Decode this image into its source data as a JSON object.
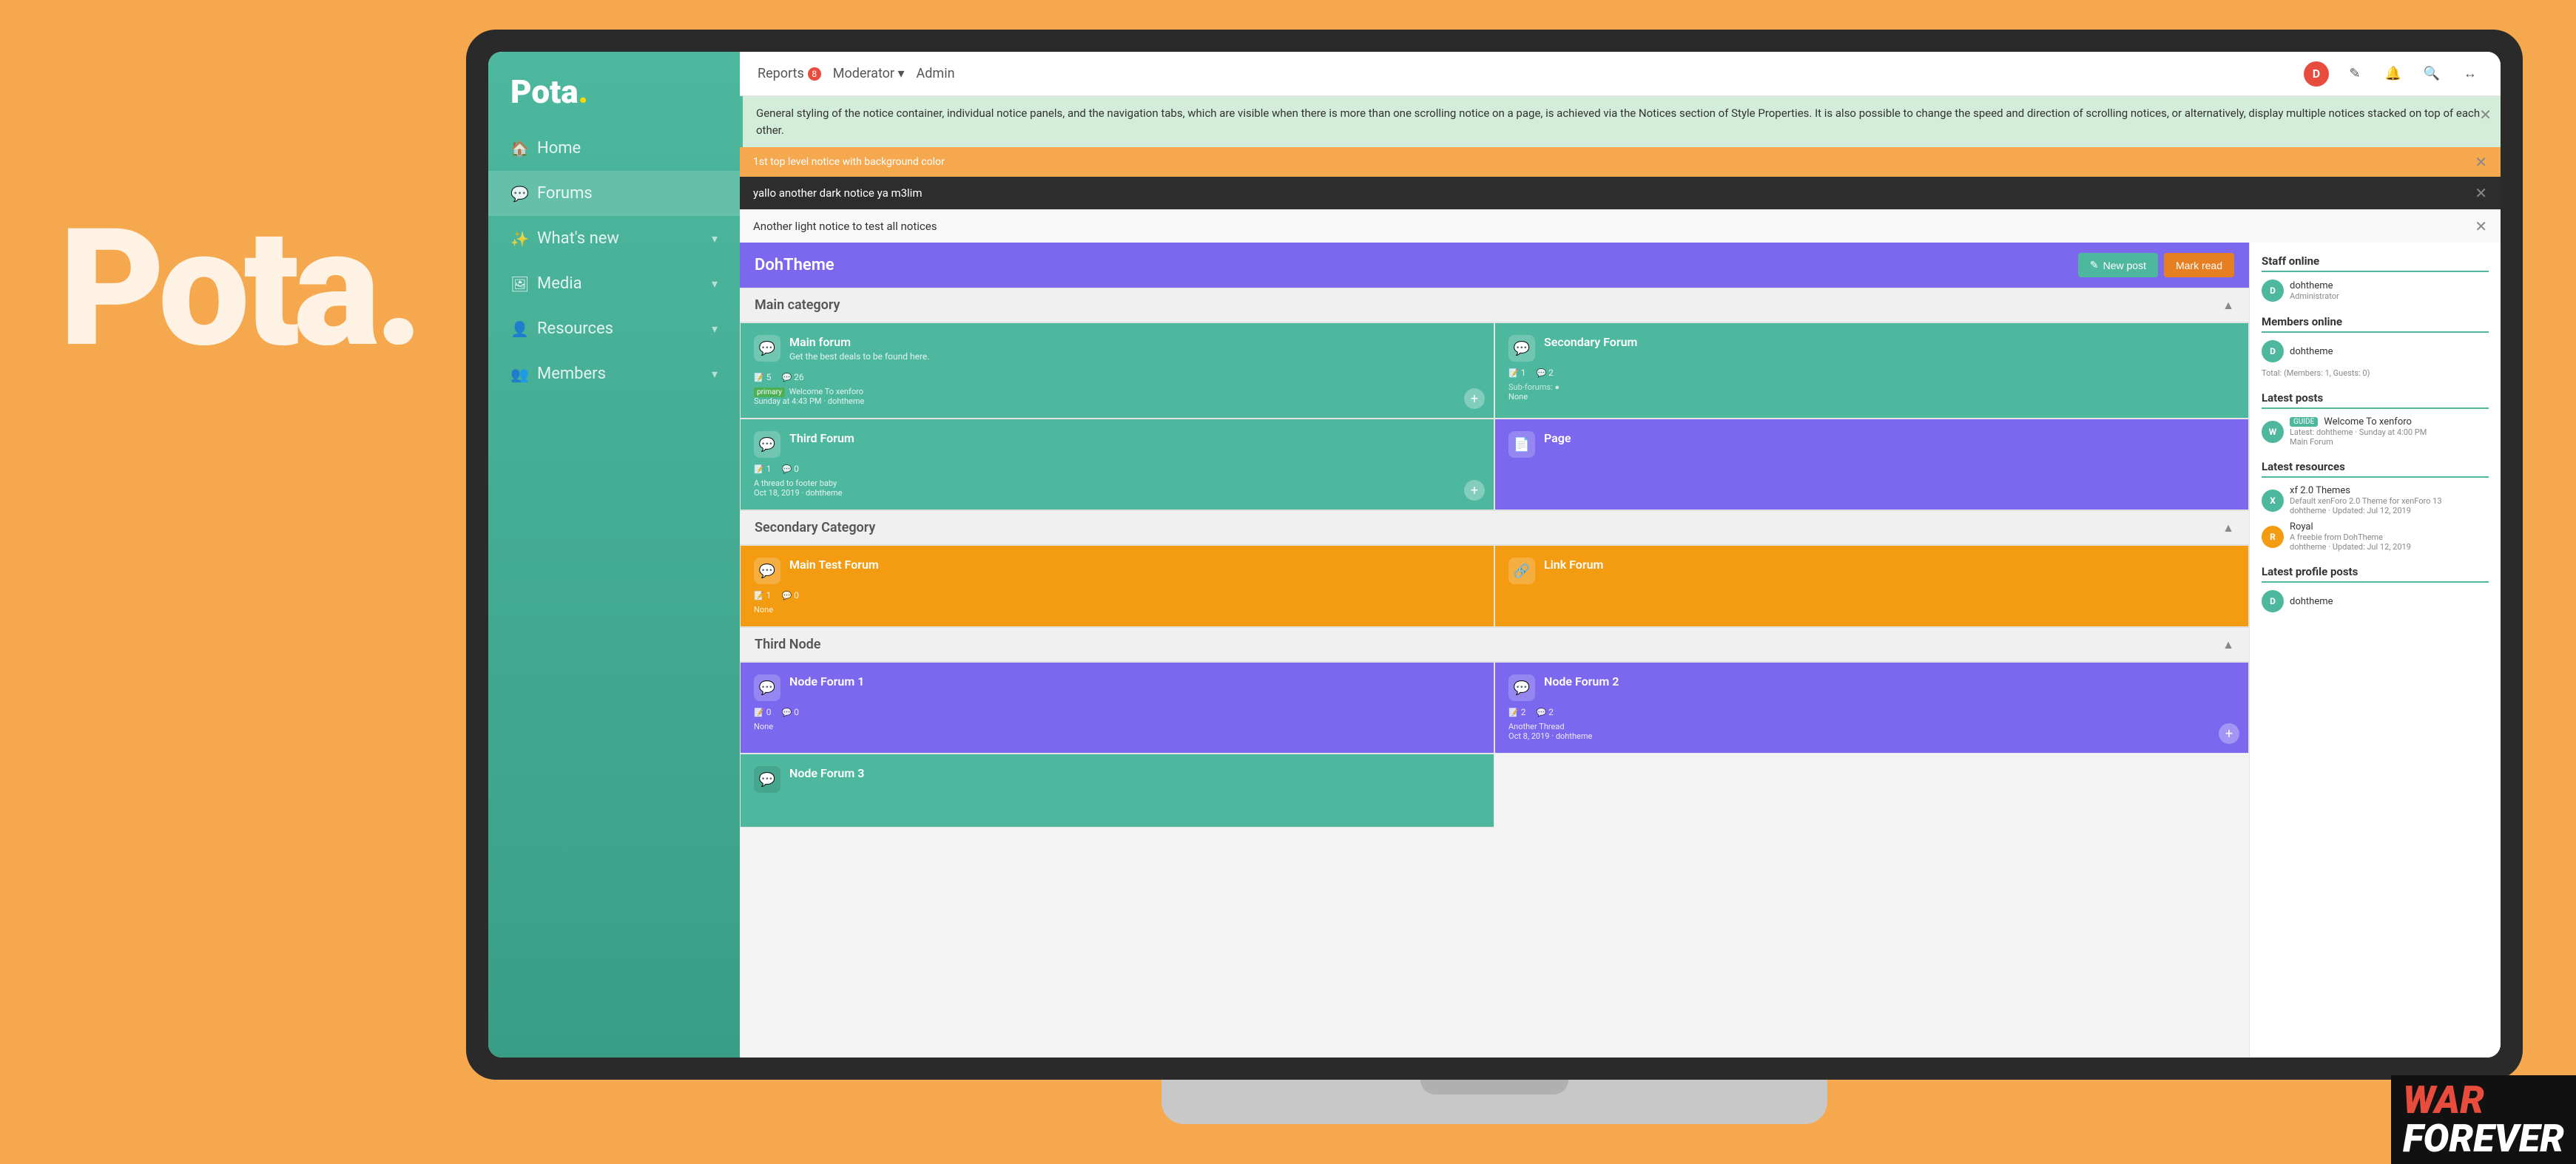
{
  "background": {
    "color": "#F5A84E"
  },
  "big_logo": "Pota.",
  "sidebar": {
    "logo": "Pota.",
    "logo_dot": ".",
    "nav_items": [
      {
        "id": "home",
        "icon": "🏠",
        "label": "Home",
        "active": false
      },
      {
        "id": "forums",
        "icon": "💬",
        "label": "Forums",
        "active": true
      },
      {
        "id": "whats-new",
        "icon": "✨",
        "label": "What's new",
        "active": false,
        "has_chevron": true
      },
      {
        "id": "media",
        "icon": "🖼",
        "label": "Media",
        "active": false,
        "has_chevron": true
      },
      {
        "id": "resources",
        "icon": "👤",
        "label": "Resources",
        "active": false,
        "has_chevron": true
      },
      {
        "id": "members",
        "icon": "👥",
        "label": "Members",
        "active": false,
        "has_chevron": true
      }
    ]
  },
  "top_navbar": {
    "links": [
      {
        "id": "reports",
        "label": "Reports",
        "badge": "8"
      },
      {
        "id": "moderator",
        "label": "Moderator ▾"
      },
      {
        "id": "admin",
        "label": "Admin"
      }
    ],
    "icons": [
      {
        "id": "avatar",
        "type": "avatar",
        "label": "D"
      },
      {
        "id": "compose",
        "symbol": "✎"
      },
      {
        "id": "alerts",
        "symbol": "🔔"
      },
      {
        "id": "search",
        "symbol": "🔍"
      },
      {
        "id": "more",
        "symbol": "↔"
      }
    ]
  },
  "notices": [
    {
      "id": "notice-green",
      "type": "green",
      "text": "General styling of the notice container, individual notice panels, and the navigation tabs, which are visible when there is more than one scrolling notice on a page, is achieved via the Notices section of Style Properties. It is also possible to change the speed and direction of scrolling notices, or alternatively, display multiple notices stacked on top of each other."
    },
    {
      "id": "notice-orange",
      "type": "orange",
      "text": "1st top level notice with background color"
    },
    {
      "id": "notice-dark",
      "type": "dark",
      "text": "yallo another dark notice ya m3lim"
    },
    {
      "id": "notice-light",
      "type": "light",
      "text": "Another light notice to test all notices"
    }
  ],
  "dohtheme": {
    "title": "DohTheme",
    "btn_new_post": "New post",
    "btn_mark_read": "Mark read"
  },
  "categories": [
    {
      "id": "main-category",
      "title": "Main category",
      "forums": [
        {
          "id": "main-forum",
          "color": "teal",
          "icon": "💬",
          "title": "Main forum",
          "desc": "Get the best deals to be found here.",
          "threads": "5",
          "messages": "26",
          "latest_prefix": "primary",
          "latest_text": "Welcome To xenforo",
          "latest_date": "Sunday at 4:43 PM",
          "latest_user": "dohtheme"
        },
        {
          "id": "secondary-forum",
          "color": "teal",
          "icon": "💬",
          "title": "Secondary Forum",
          "desc": "",
          "threads": "1",
          "messages": "2",
          "subforums": "Sub-forums: ●",
          "latest_text": "None"
        },
        {
          "id": "third-forum",
          "color": "teal",
          "icon": "💬",
          "title": "Third Forum",
          "desc": "",
          "threads": "1",
          "messages": "0",
          "latest_text": "A thread to footer baby",
          "latest_date": "Oct 18, 2019",
          "latest_user": "dohtheme"
        },
        {
          "id": "page",
          "color": "purple",
          "icon": "📄",
          "title": "Page",
          "desc": "",
          "threads": "",
          "messages": "",
          "latest_text": ""
        }
      ]
    },
    {
      "id": "secondary-category",
      "title": "Secondary Category",
      "forums": [
        {
          "id": "main-test-forum",
          "color": "orange",
          "icon": "💬",
          "title": "Main Test Forum",
          "desc": "",
          "threads": "1",
          "messages": "0",
          "latest_text": "None"
        },
        {
          "id": "link-forum",
          "color": "orange",
          "icon": "🔗",
          "title": "Link Forum",
          "desc": "",
          "threads": "",
          "messages": "",
          "latest_text": ""
        }
      ]
    },
    {
      "id": "third-node",
      "title": "Third Node",
      "forums": [
        {
          "id": "node-forum-1",
          "color": "purple",
          "icon": "💬",
          "title": "Node Forum 1",
          "desc": "",
          "threads": "0",
          "messages": "0",
          "latest_text": "None"
        },
        {
          "id": "node-forum-2",
          "color": "purple",
          "icon": "💬",
          "title": "Node Forum 2",
          "desc": "",
          "threads": "2",
          "messages": "2",
          "latest_text": "Another Thread",
          "latest_date": "Oct 8, 2019",
          "latest_user": "dohtheme"
        },
        {
          "id": "node-forum-3",
          "color": "teal",
          "icon": "💬",
          "title": "Node Forum 3",
          "desc": "",
          "threads": "",
          "messages": "",
          "latest_text": ""
        }
      ]
    }
  ],
  "right_sidebar": {
    "staff_online": {
      "title": "Staff online",
      "members": [
        {
          "id": "dohtheme-staff",
          "name": "dohtheme",
          "role": "Administrator",
          "avatar_color": "green",
          "avatar_text": "D"
        }
      ]
    },
    "members_online": {
      "title": "Members online",
      "members": [
        {
          "id": "dohtheme-member",
          "name": "dohtheme",
          "avatar_color": "green",
          "avatar_text": "D"
        }
      ],
      "count_text": "Total: (Members: 1, Guests: 0)"
    },
    "latest_posts": {
      "title": "Latest posts",
      "posts": [
        {
          "id": "post-1",
          "badge": "GUIDE",
          "title": "Welcome To xenforo",
          "meta": "Latest: dohtheme · Sunday at 4:00 PM",
          "forum": "Main Forum"
        }
      ]
    },
    "latest_resources": {
      "title": "Latest resources",
      "items": [
        {
          "id": "res-1",
          "title": "xf 2.0 Themes",
          "desc": "Default xenForo 2.0 Theme for xenForo 13",
          "meta": "dohtheme · Updated: Jul 12, 2019",
          "avatar_color": "green",
          "avatar_text": "X"
        },
        {
          "id": "res-2",
          "title": "Royal",
          "desc": "A freebie from DohTheme",
          "meta": "dohtheme · Updated: Jul 12, 2019",
          "avatar_color": "orange",
          "avatar_text": "R"
        }
      ]
    },
    "latest_profile_posts": {
      "title": "Latest profile posts",
      "posts": [
        {
          "id": "pp-1",
          "name": "dohtheme",
          "avatar_color": "green",
          "avatar_text": "D"
        }
      ]
    }
  },
  "war_forever": {
    "war": "WAR",
    "forever": "FOREVER"
  }
}
